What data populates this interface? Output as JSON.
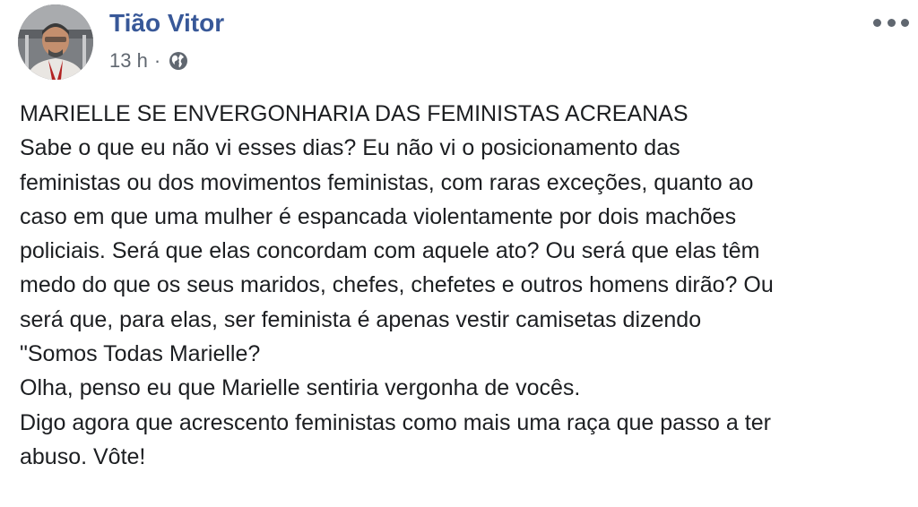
{
  "post": {
    "author_name": "Tião Vitor",
    "timestamp": "13 h",
    "separator": "·",
    "privacy_icon": "globe-icon",
    "more_icon": "more-options-icon",
    "author_color": "#385898",
    "text_lines": [
      "MARIELLE SE ENVERGONHARIA DAS FEMINISTAS ACREANAS",
      "Sabe o que eu não vi esses dias? Eu não vi o posicionamento das",
      "feministas ou dos movimentos feministas, com raras exceções, quanto ao",
      "caso em que uma mulher é espancada violentamente por dois machões",
      "policiais. Será que elas concordam com aquele ato? Ou será que elas têm",
      "medo do que os seus maridos, chefes, chefetes e outros homens dirão? Ou",
      "será que, para elas, ser feminista é apenas vestir camisetas dizendo",
      "\"Somos Todas Marielle?",
      "Olha, penso eu que Marielle sentiria vergonha de vocês.",
      "Digo agora que acrescento feministas como mais uma raça que passo a ter",
      "abuso. Vôte!"
    ]
  }
}
